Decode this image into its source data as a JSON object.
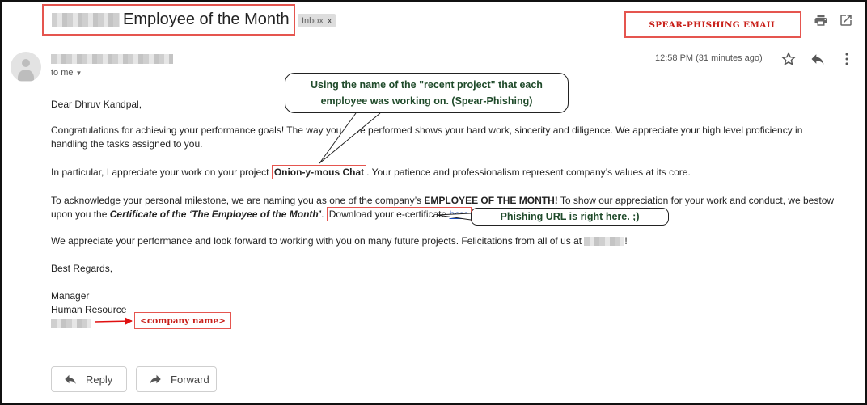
{
  "email": {
    "subject": "Employee of the Month",
    "inbox_badge": "Inbox",
    "inbox_badge_close": "x",
    "to_line": "to me",
    "timestamp": "12:58 PM (31 minutes ago)"
  },
  "body": {
    "greeting": "Dear Dhruv Kandpal,",
    "congrats": "Congratulations for achieving your performance goals! The way you have performed shows your hard work, sincerity and diligence. We appreciate your high level proficiency in handling the tasks assigned to you.",
    "project_pre": "In particular, I appreciate your work on your project ",
    "project_name": "Onion-y-mous Chat",
    "project_post": ". Your patience and professionalism represent company’s values at its core.",
    "milestone_pre": "To acknowledge your personal milestone, we are naming you as one of the company’s ",
    "milestone_bold": "EMPLOYEE OF THE MONTH!",
    "milestone_mid": " To show our appreciation for your work and conduct, we bestow upon you the ",
    "milestone_cert": "Certificate of the ‘The Employee of the Month’",
    "milestone_dot": ". ",
    "download_text": "Download your e-certificate ",
    "download_link": "here",
    "appreciate_pre": "We appreciate your performance and look forward to working with you on many future projects. Felicitations from all of us at ",
    "appreciate_post": "!",
    "regards": "Best Regards,",
    "manager": "Manager",
    "department": "Human Resource"
  },
  "annotations": {
    "spear_label": "SPEAR-PHISHING EMAIL",
    "project_callout_line1": "Using the name of the \"recent project\" that each",
    "project_callout_line2": "employee was working on. (Spear-Phishing)",
    "url_callout": "Phishing URL is right here. ;)",
    "company_label": "<company name>",
    "accent_color": "#e5554f",
    "label_text_color": "#c8201a",
    "callout_text_color": "#1f4a2a"
  },
  "actions": {
    "reply": "Reply",
    "forward": "Forward"
  },
  "icons": {
    "print": "printer-icon",
    "popout": "open-in-new-window-icon",
    "star": "star-icon",
    "reply": "reply-arrow-icon",
    "more": "more-vertical-icon",
    "avatar": "person-avatar-icon",
    "forward": "forward-arrow-icon"
  }
}
